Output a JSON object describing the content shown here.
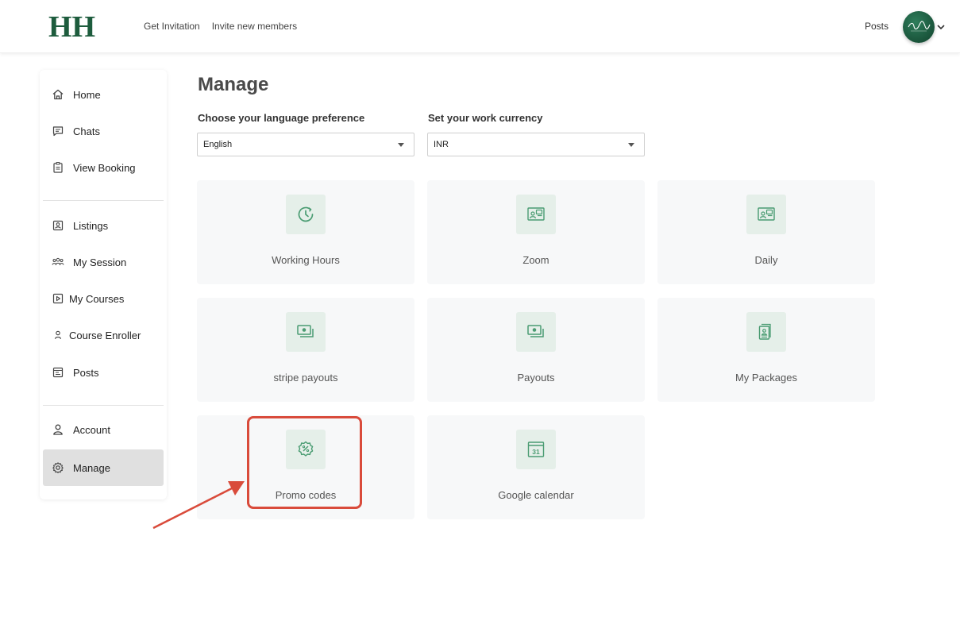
{
  "header": {
    "logo": "HH",
    "nav": [
      {
        "label": "Get Invitation"
      },
      {
        "label": "Invite new members"
      }
    ],
    "posts_link": "Posts",
    "avatar_icon": "user-avatar-icon",
    "menu_icon": "chevron-down-icon"
  },
  "sidebar": {
    "groups": [
      [
        {
          "label": "Home",
          "icon": "home-icon"
        },
        {
          "label": "Chats",
          "icon": "chat-icon"
        },
        {
          "label": "View Booking",
          "icon": "clipboard-icon"
        }
      ],
      [
        {
          "label": "Listings",
          "icon": "listing-icon"
        },
        {
          "label": "My Session",
          "icon": "group-icon"
        },
        {
          "label": "My Courses",
          "icon": "play-icon"
        },
        {
          "label": "Course Enroller",
          "icon": "person-icon"
        },
        {
          "label": "Posts",
          "icon": "posts-icon"
        }
      ],
      [
        {
          "label": "Account",
          "icon": "account-icon"
        },
        {
          "label": "Manage",
          "icon": "gear-icon",
          "active": true
        }
      ]
    ]
  },
  "main": {
    "title": "Manage",
    "language": {
      "label": "Choose your language preference",
      "value": "English"
    },
    "currency": {
      "label": "Set your work currency",
      "value": "INR"
    },
    "cards": [
      {
        "label": "Working Hours",
        "icon": "clock-icon"
      },
      {
        "label": "Zoom",
        "icon": "video-card-icon"
      },
      {
        "label": "Daily",
        "icon": "video-card-icon"
      },
      {
        "label": "stripe payouts",
        "icon": "money-icon"
      },
      {
        "label": "Payouts",
        "icon": "money-icon"
      },
      {
        "label": "My Packages",
        "icon": "package-icon"
      },
      {
        "label": "Promo codes",
        "icon": "percent-badge-icon"
      },
      {
        "label": "Google calendar",
        "icon": "calendar-icon"
      }
    ]
  },
  "annotation": {
    "highlight_color": "#d94b3b",
    "highlighted_card": "Promo codes"
  },
  "colors": {
    "brand": "#1d5c3d",
    "icon_green": "#4a9c72",
    "tile_bg": "#e5efe9",
    "card_bg": "#f7f8f9"
  }
}
